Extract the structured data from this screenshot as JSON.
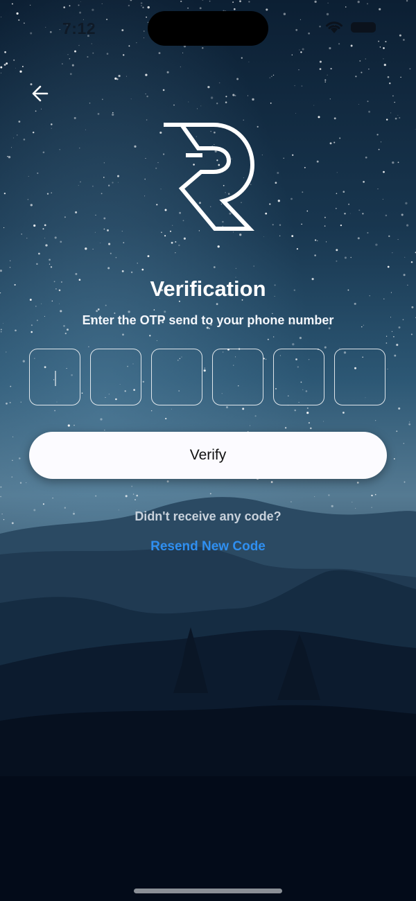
{
  "status_bar": {
    "time": "7:12",
    "icons": [
      "dynamic-island",
      "wifi-icon",
      "battery-icon"
    ]
  },
  "nav": {
    "back_icon": "arrow-left-icon"
  },
  "logo": {
    "name": "r-logo"
  },
  "verification": {
    "title": "Verification",
    "subtitle": "Enter the OTP send to your phone number",
    "otp_digits": [
      "",
      "",
      "",
      "",
      "",
      ""
    ],
    "verify_label": "Verify",
    "no_code_text": "Didn't receive any code?",
    "resend_label": "Resend New Code"
  },
  "colors": {
    "accent": "#2f8ff0",
    "button_bg": "#fcfbff",
    "sky_top": "#0d2238",
    "sky_mid": "#2a5675",
    "ground": "#020815"
  }
}
